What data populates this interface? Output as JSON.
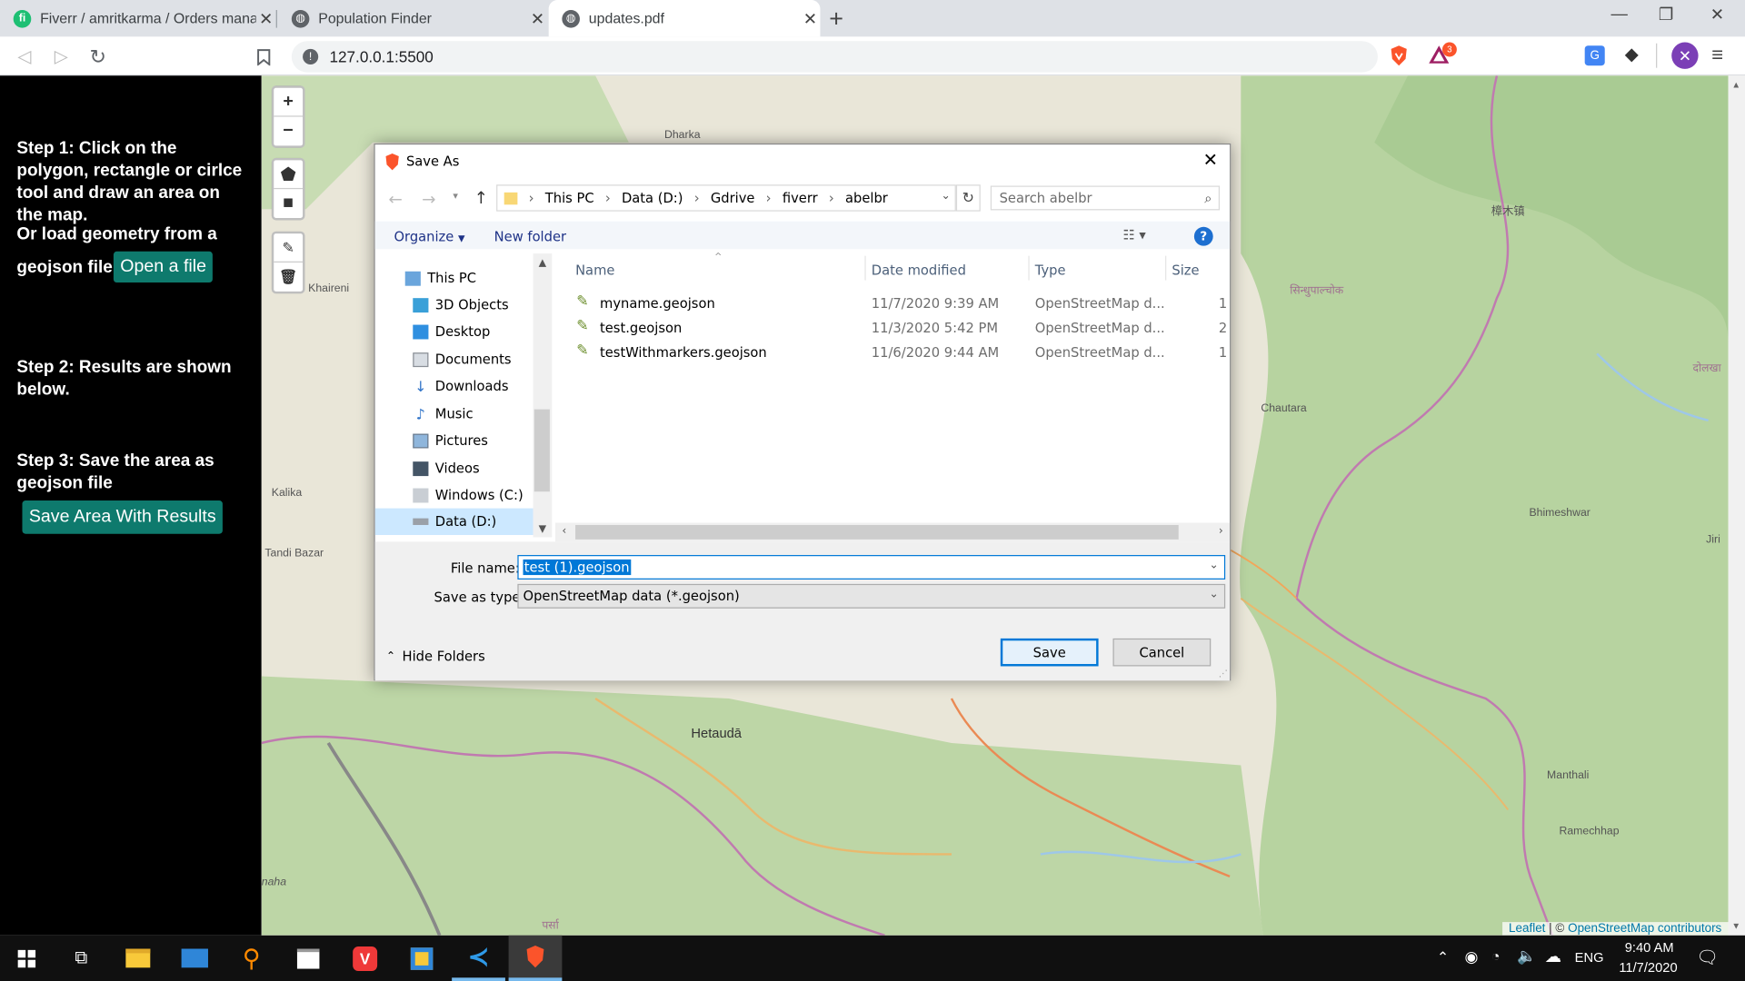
{
  "browser": {
    "tabs": [
      {
        "title": "Fiverr / amritkarma / Orders mana",
        "icon": "fiverr-icon"
      },
      {
        "title": "Population Finder",
        "icon": "globe-icon"
      },
      {
        "title": "updates.pdf",
        "icon": "globe-icon"
      }
    ],
    "url": "127.0.0.1:5500",
    "badge_count": "3"
  },
  "sidebar": {
    "step1": "Step 1: Click on the polygon, rectangle or cirlce tool and draw an area on the map.",
    "or_load_prefix": "Or load geometry from a",
    "or_load_suffix": "geojson file",
    "open_file": "Open a file",
    "step2": "Step 2: Results are shown below.",
    "step3": "Step 3: Save the area as geojson file",
    "save_area": "Save Area With Results"
  },
  "map": {
    "zoom_in": "+",
    "zoom_out": "−",
    "places": {
      "dharka": "Dharka",
      "khaireni": "Khaireni",
      "kalika": "Kalika",
      "tandi_bazar": "Tandi Bazar",
      "hetauda": "Hetaudā",
      "chautara": "Chautara",
      "bhimeshwar": "Bhimeshwar",
      "jiri": "Jiri",
      "manthali": "Manthali",
      "ramechhap": "Ramechhap",
      "zhangmu": "樟木镇",
      "sindhupalchok": "सिन्धुपाल्चोक",
      "dolakha": "दोलखा",
      "parsa": "पर्सा",
      "naha": "naha"
    },
    "attribution_leaflet": "Leaflet",
    "attribution_sep": " | © ",
    "attribution_osm": "OpenStreetMap contributors"
  },
  "dialog": {
    "title": "Save As",
    "breadcrumb": [
      "This PC",
      "Data (D:)",
      "Gdrive",
      "fiverr",
      "abelbr"
    ],
    "search_placeholder": "Search abelbr",
    "organize": "Organize",
    "new_folder": "New folder",
    "tree": [
      "This PC",
      "3D Objects",
      "Desktop",
      "Documents",
      "Downloads",
      "Music",
      "Pictures",
      "Videos",
      "Windows (C:)",
      "Data (D:)"
    ],
    "columns": [
      "Name",
      "Date modified",
      "Type",
      "Size"
    ],
    "files": [
      {
        "name": "myname.geojson",
        "date": "11/7/2020 9:39 AM",
        "type": "OpenStreetMap d...",
        "size": "1"
      },
      {
        "name": "test.geojson",
        "date": "11/3/2020 5:42 PM",
        "type": "OpenStreetMap d...",
        "size": "2"
      },
      {
        "name": "testWithmarkers.geojson",
        "date": "11/6/2020 9:44 AM",
        "type": "OpenStreetMap d...",
        "size": "1"
      }
    ],
    "file_name_label": "File name:",
    "file_name_value": "test (1).geojson",
    "save_type_label": "Save as type:",
    "save_type_value": "OpenStreetMap data (*.geojson)",
    "hide_folders": "Hide Folders",
    "save": "Save",
    "cancel": "Cancel"
  },
  "taskbar": {
    "language": "ENG",
    "time": "9:40 AM",
    "date": "11/7/2020"
  },
  "colors": {
    "sidebar_button": "#0e7a6d",
    "accent": "#0078d7",
    "map_land": "#e9e6d8",
    "map_forest": "#b7d3a0"
  }
}
